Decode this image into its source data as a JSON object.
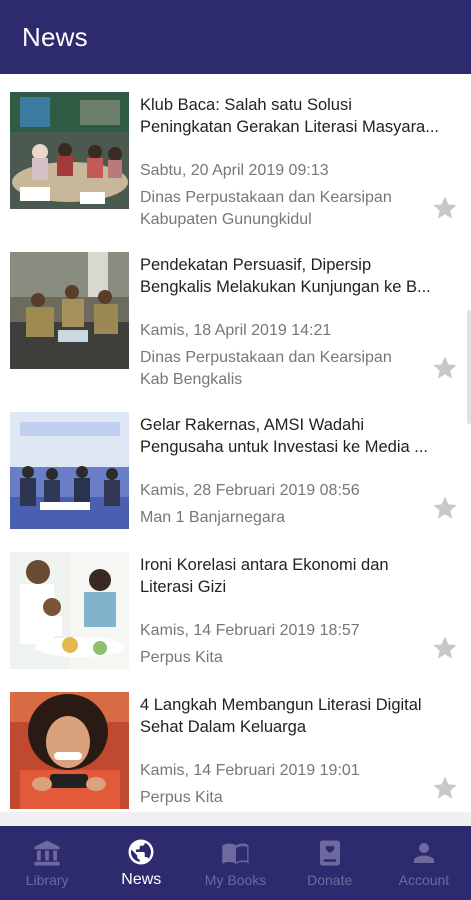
{
  "appbar": {
    "title": "News"
  },
  "articles": [
    {
      "title_lines": [
        "Klub Baca: Salah satu Solusi",
        "Peningkatan Gerakan Literasi Masyara..."
      ],
      "date": "Sabtu, 20 April 2019 09:13",
      "source_lines": [
        "Dinas Perpustakaan dan Kearsipan",
        "Kabupaten Gunungkidul"
      ]
    },
    {
      "title_lines": [
        "Pendekatan Persuasif, Dipersip",
        "Bengkalis Melakukan Kunjungan ke B..."
      ],
      "date": "Kamis, 18 April 2019 14:21",
      "source_lines": [
        "Dinas Perpustakaan dan Kearsipan",
        "Kab Bengkalis"
      ]
    },
    {
      "title_lines": [
        "Gelar Rakernas, AMSI Wadahi",
        "Pengusaha untuk Investasi ke Media ..."
      ],
      "date": "Kamis, 28 Februari 2019 08:56",
      "source_lines": [
        "Man 1 Banjarnegara",
        ""
      ]
    },
    {
      "title_lines": [
        "Ironi Korelasi antara Ekonomi dan",
        "Literasi Gizi"
      ],
      "date": "Kamis, 14 Februari 2019 18:57",
      "source_lines": [
        "Perpus Kita",
        ""
      ]
    },
    {
      "title_lines": [
        "4 Langkah Membangun Literasi Digital",
        "Sehat Dalam Keluarga"
      ],
      "date": "Kamis, 14 Februari 2019 19:01",
      "source_lines": [
        "Perpus Kita",
        ""
      ]
    }
  ],
  "nav": {
    "items": [
      {
        "label": "Library",
        "icon": "library-icon"
      },
      {
        "label": "News",
        "icon": "globe-icon"
      },
      {
        "label": "My Books",
        "icon": "book-icon"
      },
      {
        "label": "Donate",
        "icon": "donate-book-icon"
      },
      {
        "label": "Account",
        "icon": "person-icon"
      }
    ],
    "active": "News"
  },
  "colors": {
    "primary": "#2e2a6e",
    "nav_inactive": "#6c6a9e",
    "star": "#c8c8c8",
    "meta_text": "#777777"
  }
}
